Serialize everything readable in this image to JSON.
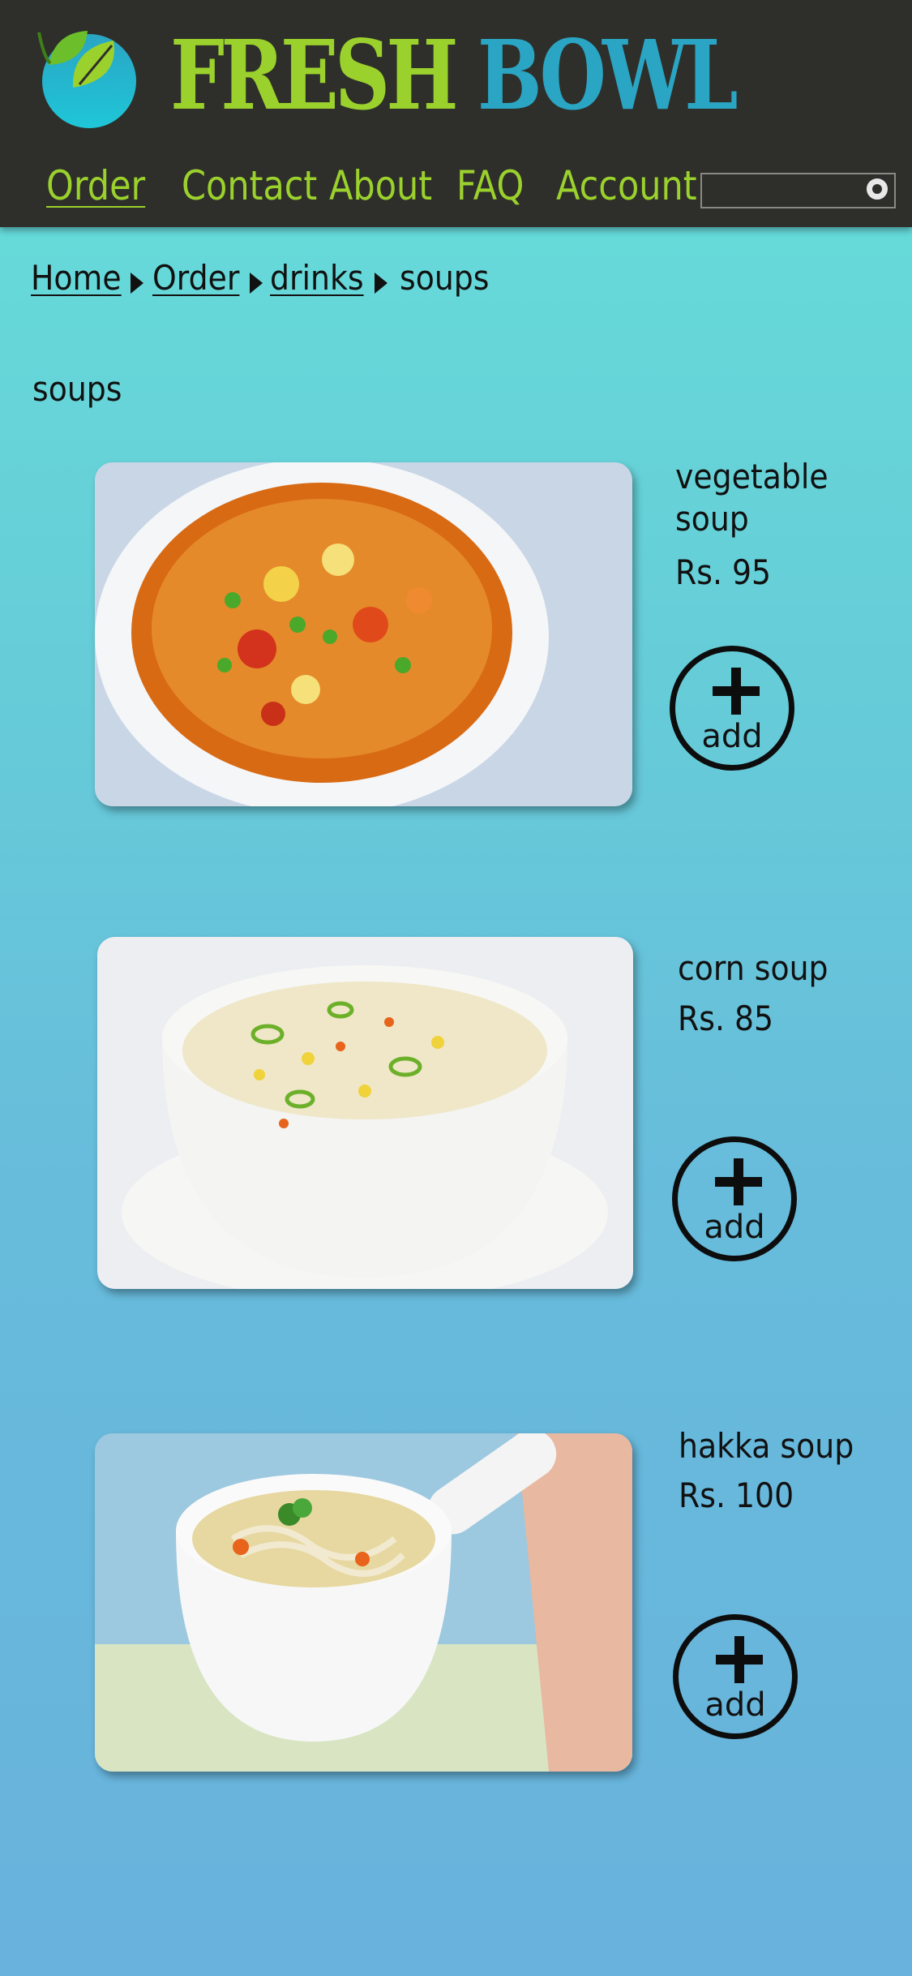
{
  "brand": {
    "word1": "FRESH",
    "word2": "BOWL",
    "logo_icon": "leaf-bowl-icon"
  },
  "nav": {
    "items": [
      {
        "label": "Order",
        "active": true
      },
      {
        "label": "Contact",
        "active": false
      },
      {
        "label": "About",
        "active": false
      },
      {
        "label": "FAQ",
        "active": false
      },
      {
        "label": "Account",
        "active": false
      }
    ]
  },
  "search": {
    "value": "",
    "placeholder": "",
    "icon": "search-icon"
  },
  "breadcrumb": [
    {
      "label": "Home",
      "link": true
    },
    {
      "label": "Order",
      "link": true
    },
    {
      "label": "drinks",
      "link": true
    },
    {
      "label": "soups",
      "link": false
    }
  ],
  "page": {
    "title": "soups"
  },
  "products": [
    {
      "name_line1": "vegetable",
      "name_line2": "soup",
      "price": "Rs. 95",
      "add_label": "add"
    },
    {
      "name": "corn soup",
      "price": "Rs. 85",
      "add_label": "add"
    },
    {
      "name": "hakka soup",
      "price": "Rs. 100",
      "add_label": "add"
    }
  ],
  "colors": {
    "header_bg": "#2e2f2a",
    "brand_green": "#9bd12d",
    "brand_blue": "#2aa5c4",
    "bg_top": "#66e0da",
    "bg_bottom": "#68b2dd"
  }
}
